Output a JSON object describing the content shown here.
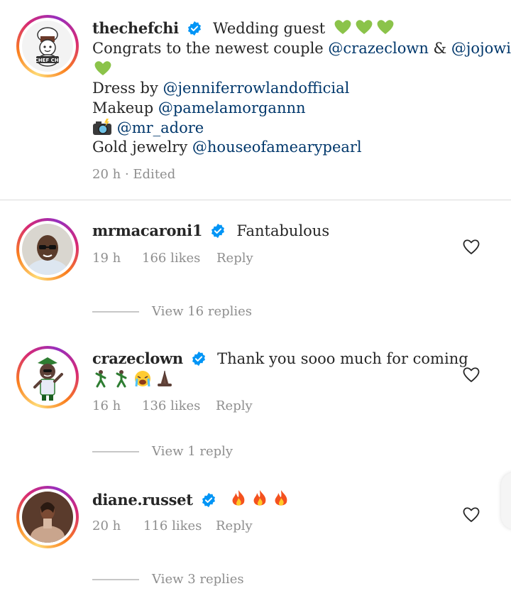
{
  "caption": {
    "username": "thechefchi",
    "headline": "Wedding guest",
    "headline_emoji": [
      "green-heart",
      "green-heart",
      "green-heart"
    ],
    "line2_text": "Congrats to the newest couple",
    "line2_mention1": "@crazeclown",
    "line2_amp": "&",
    "line2_mention2": "@jojowigs",
    "line3_emoji": "green-heart",
    "dress_label": "Dress by",
    "dress_mention": "@jenniferrowlandofficial",
    "makeup_label": "Makeup",
    "makeup_mention": "@pamelamorgannn",
    "camera_emoji": "camera-with-flash",
    "camera_mention": "@mr_adore",
    "jewelry_label": "Gold jewelry",
    "jewelry_mention": "@houseofamearypearl",
    "time": "20 h",
    "edited": "· Edited"
  },
  "comments": [
    {
      "username": "mrmacaroni1",
      "text": "Fantabulous",
      "time": "19 h",
      "likes": "166 likes",
      "reply": "Reply",
      "view_replies": "View 16 replies"
    },
    {
      "username": "crazeclown",
      "text": "Thank you sooo much for coming",
      "emoji_line": [
        "man-dancing",
        "man-dancing",
        "loudly-crying-face",
        "folded-hands"
      ],
      "time": "16 h",
      "likes": "136 likes",
      "reply": "Reply",
      "view_replies": "View 1 reply"
    },
    {
      "username": "diane.russet",
      "emoji_line": [
        "fire",
        "fire",
        "fire"
      ],
      "time": "20 h",
      "likes": "116 likes",
      "reply": "Reply",
      "view_replies": "View 3 replies"
    }
  ],
  "colors": {
    "mention": "#00376b",
    "verified": "#0095f6",
    "green_heart": "#8bc34a",
    "meta": "#8e8e8e"
  }
}
